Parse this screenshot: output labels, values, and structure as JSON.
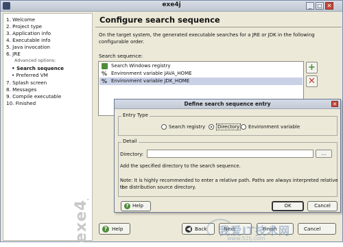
{
  "window": {
    "title": "exe4j"
  },
  "nav": {
    "items": [
      {
        "label": "1. Welcome"
      },
      {
        "label": "2. Project type"
      },
      {
        "label": "3. Application info"
      },
      {
        "label": "4. Executable info"
      },
      {
        "label": "5. Java invocation"
      },
      {
        "label": "6. JRE"
      },
      {
        "label": "Advanced options:"
      },
      {
        "label": "• Search sequence"
      },
      {
        "label": "• Preferred VM"
      },
      {
        "label": "7. Splash screen"
      },
      {
        "label": "8. Messages"
      },
      {
        "label": "9. Compile executable"
      },
      {
        "label": "10. Finished"
      }
    ],
    "brand": "exe4j"
  },
  "main": {
    "title": "Configure search sequence",
    "description": "On the target system, the generated executable searches for a JRE or JDK in the following configurable order.",
    "sequence_label": "Search sequence:",
    "sequence": [
      {
        "label": "Search Windows registry",
        "icon": "registry-icon"
      },
      {
        "label": "Environment variable JAVA_HOME",
        "icon": "percent-icon"
      },
      {
        "label": "Environment variable JDK_HOME",
        "icon": "percent-icon"
      }
    ],
    "buttons": {
      "help": "Help",
      "back": "Back",
      "next": "Next",
      "finish": "Finish",
      "cancel": "Cancel"
    }
  },
  "dialog": {
    "title": "Define search sequence entry",
    "entry_type_legend": "Entry Type",
    "entry_types": [
      {
        "label": "Search registry"
      },
      {
        "label": "Directory",
        "selected": true
      },
      {
        "label": "Environment variable"
      }
    ],
    "detail_legend": "Detail",
    "directory_label": "Directory:",
    "directory_value": "",
    "browse_label": "...",
    "info_text": "Add the specified directory to the search sequence.",
    "note_line1": "Note: It is highly recommended to enter a relative path. Paths are always interpreted relative to",
    "note_line2": "the distribution source directory.",
    "buttons": {
      "help": "Help",
      "ok": "OK",
      "cancel": "Cancel"
    }
  },
  "watermark": {
    "text": "我爱IT技术网",
    "url": "www.52ij.com"
  },
  "colors": {
    "selection": "#c9d1e6",
    "add_green": "#4e8b3a",
    "remove_red": "#c0392b"
  }
}
